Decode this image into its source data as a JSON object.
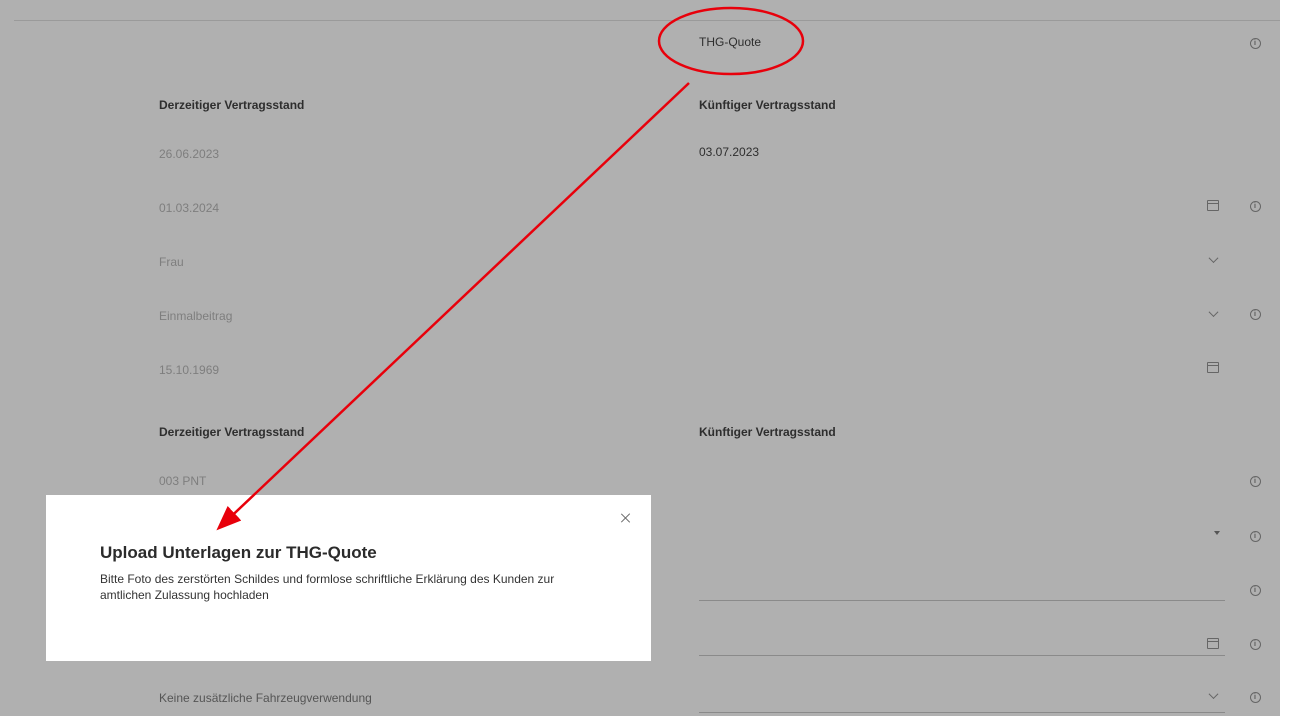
{
  "form": {
    "section_label": "THG-Quote",
    "section1": {
      "current_header": "Derzeitiger Vertragsstand",
      "future_header": "Künftiger Vertragsstand",
      "current_date": "26.06.2023",
      "future_date": "03.07.2023",
      "start_date": "01.03.2024",
      "salutation": "Frau",
      "payment": "Einmalbeitrag",
      "birth_date": "15.10.1969"
    },
    "section2": {
      "current_header": "Derzeitiger Vertragsstand",
      "future_header": "Künftiger Vertragsstand",
      "plate_code": "003 PNT",
      "vehicle_use": "Keine zusätzliche Fahrzeugverwendung"
    }
  },
  "modal": {
    "title": "Upload Unterlagen zur THG-Quote",
    "body": "Bitte Foto des zerstörten Schildes und formlose schriftliche Erklärung des Kunden zur amtlichen Zulassung hochladen"
  },
  "annotation": {
    "color": "#e8000b"
  },
  "icons": [
    "info-icon",
    "calendar-icon",
    "chevron-down-icon",
    "caret-down-icon",
    "close-icon"
  ]
}
